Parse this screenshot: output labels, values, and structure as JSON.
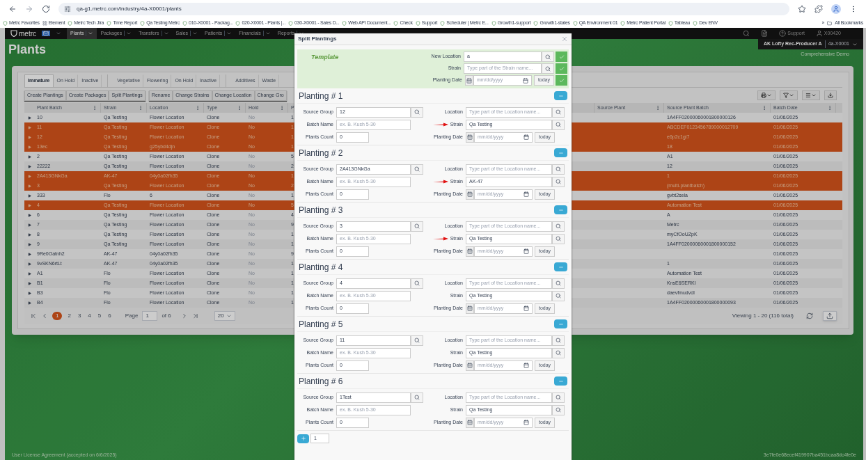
{
  "browser": {
    "url": "qa-g1.metrc.com/industry/4a-X0001/plants",
    "bookmarks": [
      "Metrc Favorites",
      "Element",
      "Metrc Tech Jira",
      "Time Report",
      "Qa Testing Metrc",
      "010-X0001 - Packag...",
      "020-X0001 - Plants |...",
      "030-X0001 - Sales D...",
      "Web API Document...",
      "Check",
      "Support",
      "Scheduler | Metrc E...",
      "Growth1-support",
      "Growth1-states",
      "QA Environment 01",
      "Metrc Patient Portal",
      "Tableau",
      "Dev ENV"
    ],
    "more": "»",
    "all_bookmarks": "All Bookmarks"
  },
  "nav": {
    "logo": "metrc",
    "menu": [
      {
        "label": "Plants",
        "selected": true
      },
      {
        "label": "Packages",
        "selected": false
      },
      {
        "label": "Transfers",
        "selected": false
      },
      {
        "label": "Sales",
        "selected": false
      },
      {
        "label": "Patients",
        "selected": false
      },
      {
        "label": "Financials",
        "selected": false
      },
      {
        "label": "Reports",
        "selected": false
      }
    ],
    "support": "Support",
    "user": "X00420",
    "facility": "AK Lofty Rec-Producer A",
    "license": "4a-X0001",
    "facility_note": "Comprehensive Demo"
  },
  "page_title": "Plants",
  "tab_groups": [
    [
      {
        "label": "Immature",
        "selected": true
      },
      {
        "label": "On Hold",
        "selected": false
      },
      {
        "label": "Inactive",
        "selected": false
      }
    ],
    [
      {
        "label": "Vegetative",
        "selected": false
      },
      {
        "label": "Flowering",
        "selected": false
      },
      {
        "label": "On Hold",
        "selected": false
      },
      {
        "label": "Inactive",
        "selected": false
      }
    ],
    [
      {
        "label": "Additives",
        "selected": false
      },
      {
        "label": "Waste",
        "selected": false
      }
    ]
  ],
  "action_groups": [
    [
      "Create Plantings",
      "Create Packages",
      "Split Plantings"
    ],
    [
      "Rename",
      "Change Strains",
      "Change Location",
      "Change Gro"
    ]
  ],
  "table": {
    "columns": [
      "Plant Batch",
      "Strain",
      "Location",
      "Type",
      "Hold",
      "P",
      "Source Plant",
      "Source Plant Batch",
      "Batch Date"
    ],
    "rows": [
      {
        "plant_batch": "10",
        "strain": "Qa Testing",
        "location": "Flower Location",
        "type": "Clone",
        "hold": "No",
        "column_6": "1",
        "source_plant_batch": "1A4FF02000060001800000126",
        "batch_date": "01/06/2025",
        "selected": false
      },
      {
        "plant_batch": "11",
        "strain": "Qa Testing",
        "location": "Flower Location",
        "type": "Clone",
        "hold": "No",
        "column_6": "1",
        "source_plant_batch": "ABCDEF0123456789000012709",
        "batch_date": "01/06/2025",
        "selected": true
      },
      {
        "plant_batch": "12",
        "strain": "Qa Testing",
        "location": "Flower Location",
        "type": "Clone",
        "hold": "No",
        "column_6": "1",
        "source_plant_batch": "e6p2c1gi7",
        "batch_date": "01/06/2025",
        "selected": true
      },
      {
        "plant_batch": "13ec",
        "strain": "Qa Testing",
        "location": "g25ybd4djn",
        "type": "Clone",
        "hold": "No",
        "column_6": "1",
        "source_plant_batch": "18",
        "batch_date": "01/06/2025",
        "selected": true
      },
      {
        "plant_batch": "2",
        "strain": "Qa Testing",
        "location": "Flower Location",
        "type": "Clone",
        "hold": "No",
        "column_6": "5",
        "source_plant_batch": "A1",
        "batch_date": "01/06/2025",
        "selected": false
      },
      {
        "plant_batch": "22222",
        "strain": "Qa Testing",
        "location": "Flower Location",
        "type": "Clone",
        "hold": "No",
        "column_6": "2",
        "source_plant_batch": "12",
        "batch_date": "01/06/2025",
        "selected": false
      },
      {
        "plant_batch": "2A413GNkGa",
        "strain": "AK-47",
        "location": "04y0a02fh35",
        "type": "Clone",
        "hold": "No",
        "column_6": "1",
        "source_plant_batch": "1",
        "batch_date": "01/06/2025",
        "selected": true
      },
      {
        "plant_batch": "3",
        "strain": "Qa Testing",
        "location": "Flower Location",
        "type": "Clone",
        "hold": "No",
        "column_6": "2",
        "source_plant_batch": "(multi-plantbatch)",
        "batch_date": "01/06/2025",
        "selected": true
      },
      {
        "plant_batch": "333",
        "strain": "Flo",
        "location": "6",
        "type": "Clone",
        "hold": "No",
        "column_6": "1",
        "source_plant_batch": "gvbt2sela",
        "batch_date": "01/06/2025",
        "selected": false
      },
      {
        "plant_batch": "4",
        "strain": "Qa Testing",
        "location": "Flower Location",
        "type": "Clone",
        "hold": "No",
        "column_6": "5",
        "source_plant_batch": "Automation Test",
        "batch_date": "01/06/2025",
        "selected": true
      },
      {
        "plant_batch": "6",
        "strain": "Qa Testing",
        "location": "Flower Location",
        "type": "Clone",
        "hold": "No",
        "column_6": "4",
        "source_plant_batch": "A",
        "batch_date": "01/06/2025",
        "selected": false
      },
      {
        "plant_batch": "7",
        "strain": "Qa Testing",
        "location": "Flower Location",
        "type": "Clone",
        "hold": "No",
        "column_6": "9",
        "source_plant_batch": "Metrc",
        "batch_date": "01/06/2025",
        "selected": false
      },
      {
        "plant_batch": "8",
        "strain": "Qa Testing",
        "location": "Flower Location",
        "type": "Clone",
        "hold": "No",
        "column_6": "1",
        "source_plant_batch": "myCfOoUZpK",
        "batch_date": "01/06/2025",
        "selected": false
      },
      {
        "plant_batch": "9",
        "strain": "Qa Testing",
        "location": "Flower Location",
        "type": "Clone",
        "hold": "No",
        "column_6": "1",
        "source_plant_batch": "1A4FF02000060001800000152",
        "batch_date": "01/06/2025",
        "selected": false
      },
      {
        "plant_batch": "9Re0Oatnh2",
        "strain": "AK-47",
        "location": "04y0a02fh35",
        "type": "Clone",
        "hold": "No",
        "column_6": "9",
        "batch_date": "01/06/2025",
        "selected": false
      },
      {
        "plant_batch": "9vSKN6rtLt",
        "strain": "AK-47",
        "location": "04y0a02fh35",
        "type": "Clone",
        "hold": "No",
        "column_6": "1",
        "source_plant_batch": "1",
        "batch_date": "01/06/2025",
        "selected": false
      },
      {
        "plant_batch": "A1",
        "strain": "Flo",
        "location": "Flower Location",
        "type": "Clone",
        "hold": "No",
        "column_6": "1",
        "source_plant_batch": "Automation Test",
        "batch_date": "01/06/2025",
        "selected": false
      },
      {
        "plant_batch": "B1",
        "strain": "Flo",
        "location": "Flower Location",
        "type": "Clone",
        "hold": "No",
        "column_6": "1",
        "source_plant_batch": "KnsE6SERKI",
        "batch_date": "01/06/2025",
        "selected": false
      },
      {
        "plant_batch": "B3",
        "strain": "Flo",
        "location": "Flower Location",
        "type": "Clone",
        "hold": "No",
        "column_6": "1",
        "source_plant_batch": "daevfmudvdl",
        "batch_date": "01/06/2025",
        "selected": false
      },
      {
        "plant_batch": "B4",
        "strain": "Flo",
        "location": "Flower Location",
        "type": "Clone",
        "hold": "No",
        "column_6": "1",
        "source_plant_batch": "1A4FF02000060001800000093",
        "batch_date": "01/06/2025",
        "selected": false
      }
    ]
  },
  "pagination": {
    "pages": [
      {
        "label": "1",
        "selected": true
      },
      {
        "label": "2",
        "selected": false
      },
      {
        "label": "3",
        "selected": false
      },
      {
        "label": "4",
        "selected": false
      },
      {
        "label": "5",
        "selected": false
      },
      {
        "label": "6",
        "selected": false
      }
    ],
    "page_label": "Page",
    "page_value": "1",
    "of_label": "of 6",
    "page_size": "20",
    "viewing": "Viewing 1 - 20 (116 total)"
  },
  "footer": {
    "agreement": "User License Agreement",
    "accepted": "(accepted on 6/6/2025)",
    "build": "3e7fe0e68ecef419907ba451bcaa8dc4fe0e"
  },
  "modal": {
    "title": "Split Plantings",
    "template": {
      "label": "Template",
      "fields": [
        {
          "kind": "search",
          "label": "New Location",
          "value": "a"
        },
        {
          "kind": "search",
          "label": "Strain",
          "placeholder": "Type part of the Strain name..."
        },
        {
          "kind": "date",
          "label": "Planting Date",
          "placeholder": "mm/dd/yyyy",
          "button": "today"
        }
      ]
    },
    "plantings": [
      {
        "title": "Planting # 1",
        "strain_arrow": true,
        "left": [
          {
            "kind": "search",
            "label": "Source Group",
            "value": "12"
          },
          {
            "kind": "text",
            "label": "Batch Name",
            "placeholder": "ex. B. Kush 5-30"
          },
          {
            "kind": "short",
            "label": "Plants Count",
            "value": "0"
          }
        ],
        "right": [
          {
            "kind": "search",
            "label": "Location",
            "placeholder": "Type part of the Location name..."
          },
          {
            "kind": "search",
            "label": "Strain",
            "value": "Qa Testing"
          },
          {
            "kind": "date",
            "label": "Planting Date",
            "placeholder": "mm/dd/yyyy",
            "button": "today"
          }
        ]
      },
      {
        "title": "Planting # 2",
        "strain_arrow": true,
        "left": [
          {
            "kind": "search",
            "label": "Source Group",
            "value": "2A413GNkGa"
          },
          {
            "kind": "text",
            "label": "Batch Name",
            "placeholder": "ex. B. Kush 5-30"
          },
          {
            "kind": "short",
            "label": "Plants Count",
            "value": "0"
          }
        ],
        "right": [
          {
            "kind": "search",
            "label": "Location",
            "placeholder": "Type part of the Location name..."
          },
          {
            "kind": "search",
            "label": "Strain",
            "value": "AK-47"
          },
          {
            "kind": "date",
            "label": "Planting Date",
            "placeholder": "mm/dd/yyyy",
            "button": "today"
          }
        ]
      },
      {
        "title": "Planting # 3",
        "strain_arrow": true,
        "left": [
          {
            "kind": "search",
            "label": "Source Group",
            "value": "3"
          },
          {
            "kind": "text",
            "label": "Batch Name",
            "placeholder": "ex. B. Kush 5-30"
          },
          {
            "kind": "short",
            "label": "Plants Count",
            "value": "0"
          }
        ],
        "right": [
          {
            "kind": "search",
            "label": "Location",
            "placeholder": "Type part of the Location name..."
          },
          {
            "kind": "search",
            "label": "Strain",
            "value": "Qa Testing"
          },
          {
            "kind": "date",
            "label": "Planting Date",
            "placeholder": "mm/dd/yyyy",
            "button": "today"
          }
        ]
      },
      {
        "title": "Planting # 4",
        "strain_arrow": false,
        "left": [
          {
            "kind": "search",
            "label": "Source Group",
            "value": "4"
          },
          {
            "kind": "text",
            "label": "Batch Name",
            "placeholder": "ex. B. Kush 5-30"
          },
          {
            "kind": "short",
            "label": "Plants Count",
            "value": "0"
          }
        ],
        "right": [
          {
            "kind": "search",
            "label": "Location",
            "placeholder": "Type part of the Location name..."
          },
          {
            "kind": "search",
            "label": "Strain",
            "value": "Qa Testing"
          },
          {
            "kind": "date",
            "label": "Planting Date",
            "placeholder": "mm/dd/yyyy",
            "button": "today"
          }
        ]
      },
      {
        "title": "Planting # 5",
        "strain_arrow": false,
        "left": [
          {
            "kind": "search",
            "label": "Source Group",
            "value": "11"
          },
          {
            "kind": "text",
            "label": "Batch Name",
            "placeholder": "ex. B. Kush 5-30"
          },
          {
            "kind": "short",
            "label": "Plants Count",
            "value": "0"
          }
        ],
        "right": [
          {
            "kind": "search",
            "label": "Location",
            "placeholder": "Type part of the Location name..."
          },
          {
            "kind": "search",
            "label": "Strain",
            "value": "Qa Testing"
          },
          {
            "kind": "date",
            "label": "Planting Date",
            "placeholder": "mm/dd/yyyy",
            "button": "today"
          }
        ]
      },
      {
        "title": "Planting # 6",
        "strain_arrow": false,
        "left": [
          {
            "kind": "search",
            "label": "Source Group",
            "value": "1Test"
          },
          {
            "kind": "text",
            "label": "Batch Name",
            "placeholder": "ex. B. Kush 5-30"
          },
          {
            "kind": "short",
            "label": "Plants Count",
            "value": "0"
          }
        ],
        "right": [
          {
            "kind": "search",
            "label": "Location",
            "placeholder": "Type part of the Location name..."
          },
          {
            "kind": "search",
            "label": "Strain",
            "value": "Qa Testing"
          },
          {
            "kind": "date",
            "label": "Planting Date",
            "placeholder": "mm/dd/yyyy",
            "button": "today"
          }
        ]
      }
    ],
    "add_count": "1"
  }
}
